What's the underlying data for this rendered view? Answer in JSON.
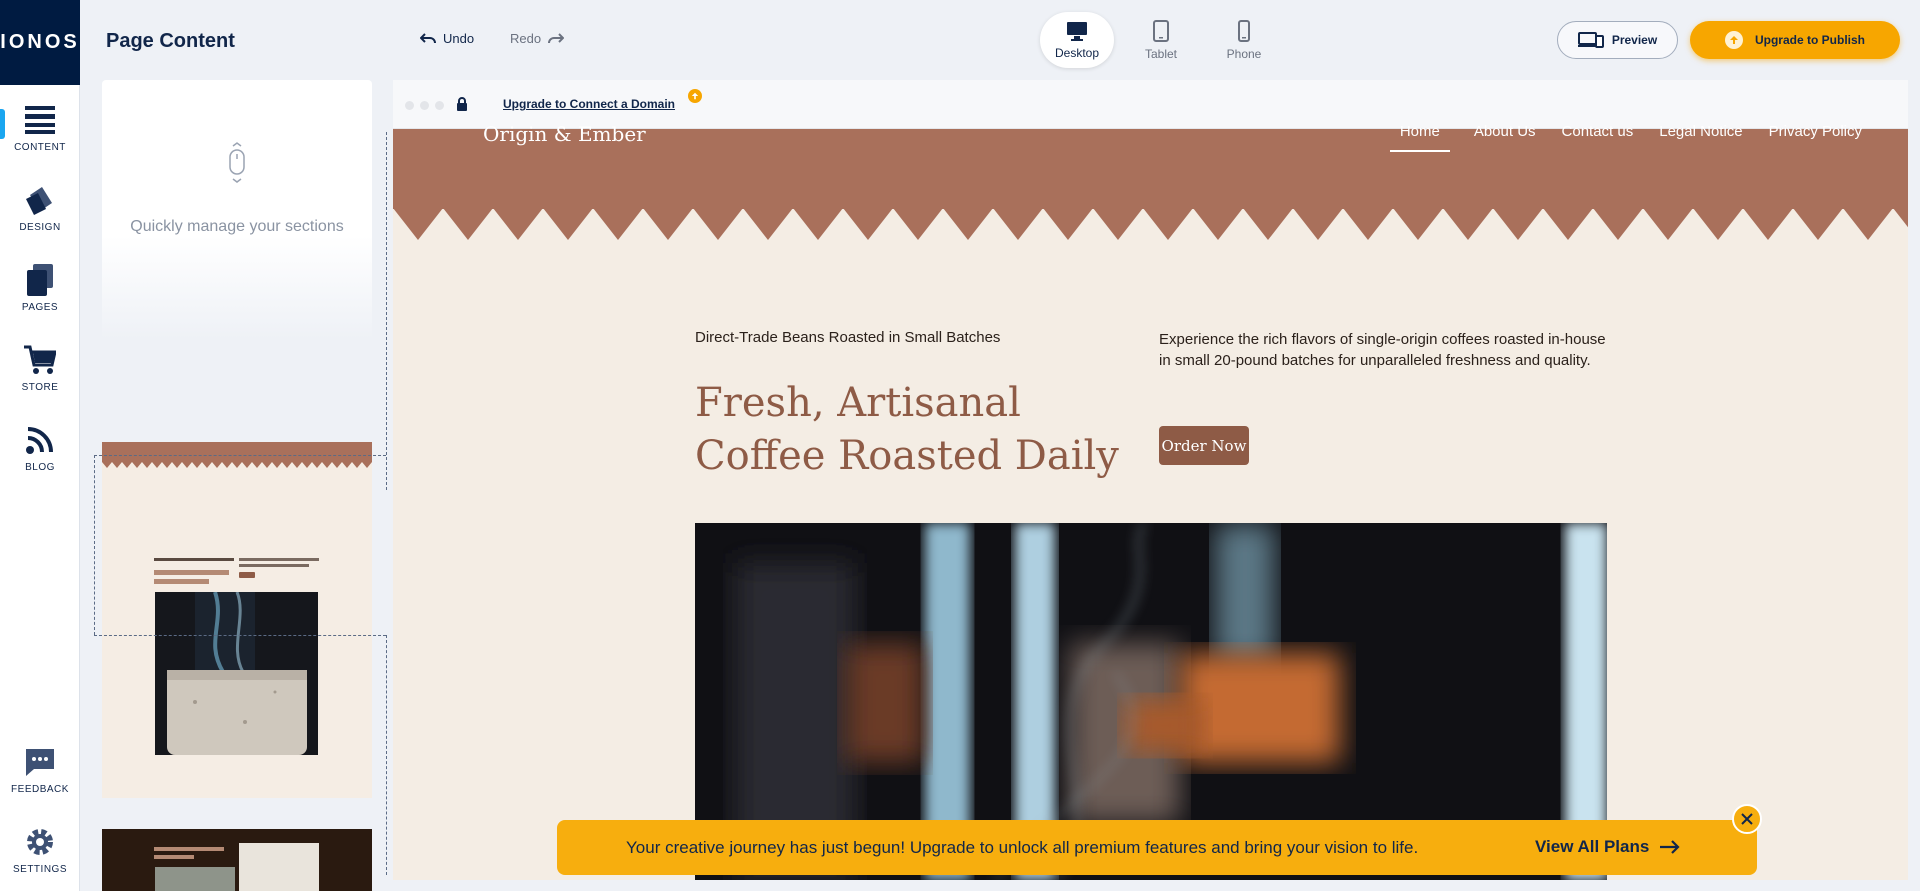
{
  "brand": {
    "logo_text": "IONOS"
  },
  "rail": {
    "items": [
      {
        "label": "CONTENT",
        "icon": "content-icon"
      },
      {
        "label": "DESIGN",
        "icon": "design-icon"
      },
      {
        "label": "PAGES",
        "icon": "pages-icon"
      },
      {
        "label": "STORE",
        "icon": "cart-icon"
      },
      {
        "label": "BLOG",
        "icon": "rss-icon"
      },
      {
        "label": "FEEDBACK",
        "icon": "chat-icon"
      },
      {
        "label": "SETTINGS",
        "icon": "gear-icon"
      }
    ]
  },
  "toolbar": {
    "title": "Page Content",
    "undo_label": "Undo",
    "redo_label": "Redo",
    "devices": [
      {
        "label": "Desktop",
        "active": true
      },
      {
        "label": "Tablet",
        "active": false
      },
      {
        "label": "Phone",
        "active": false
      }
    ],
    "preview_label": "Preview",
    "publish_label": "Upgrade to Publish"
  },
  "panel": {
    "hint": "Quickly manage your sections"
  },
  "browser": {
    "domain_link": "Upgrade to Connect a Domain"
  },
  "site": {
    "logo": "Origin & Ember",
    "nav": [
      "Home",
      "About Us",
      "Contact us",
      "Legal Notice",
      "Privacy Policy"
    ],
    "eyebrow": "Direct-Trade Beans Roasted in Small Batches",
    "title": "Fresh, Artisanal Coffee Roasted Daily",
    "description": "Experience the rich flavors of single-origin coffees roasted in-house in small 20-pound batches for unparalleled freshness and quality.",
    "cta": "Order Now"
  },
  "banner": {
    "text": "Your creative journey has just begun! Upgrade to unlock all premium features and bring your vision to life.",
    "link": "View All Plans"
  },
  "colors": {
    "accent": "#f7a600",
    "brand_dark": "#001b41",
    "site_header": "#a9705b",
    "site_bg": "#f4ede4",
    "site_accent": "#8e5b46"
  }
}
